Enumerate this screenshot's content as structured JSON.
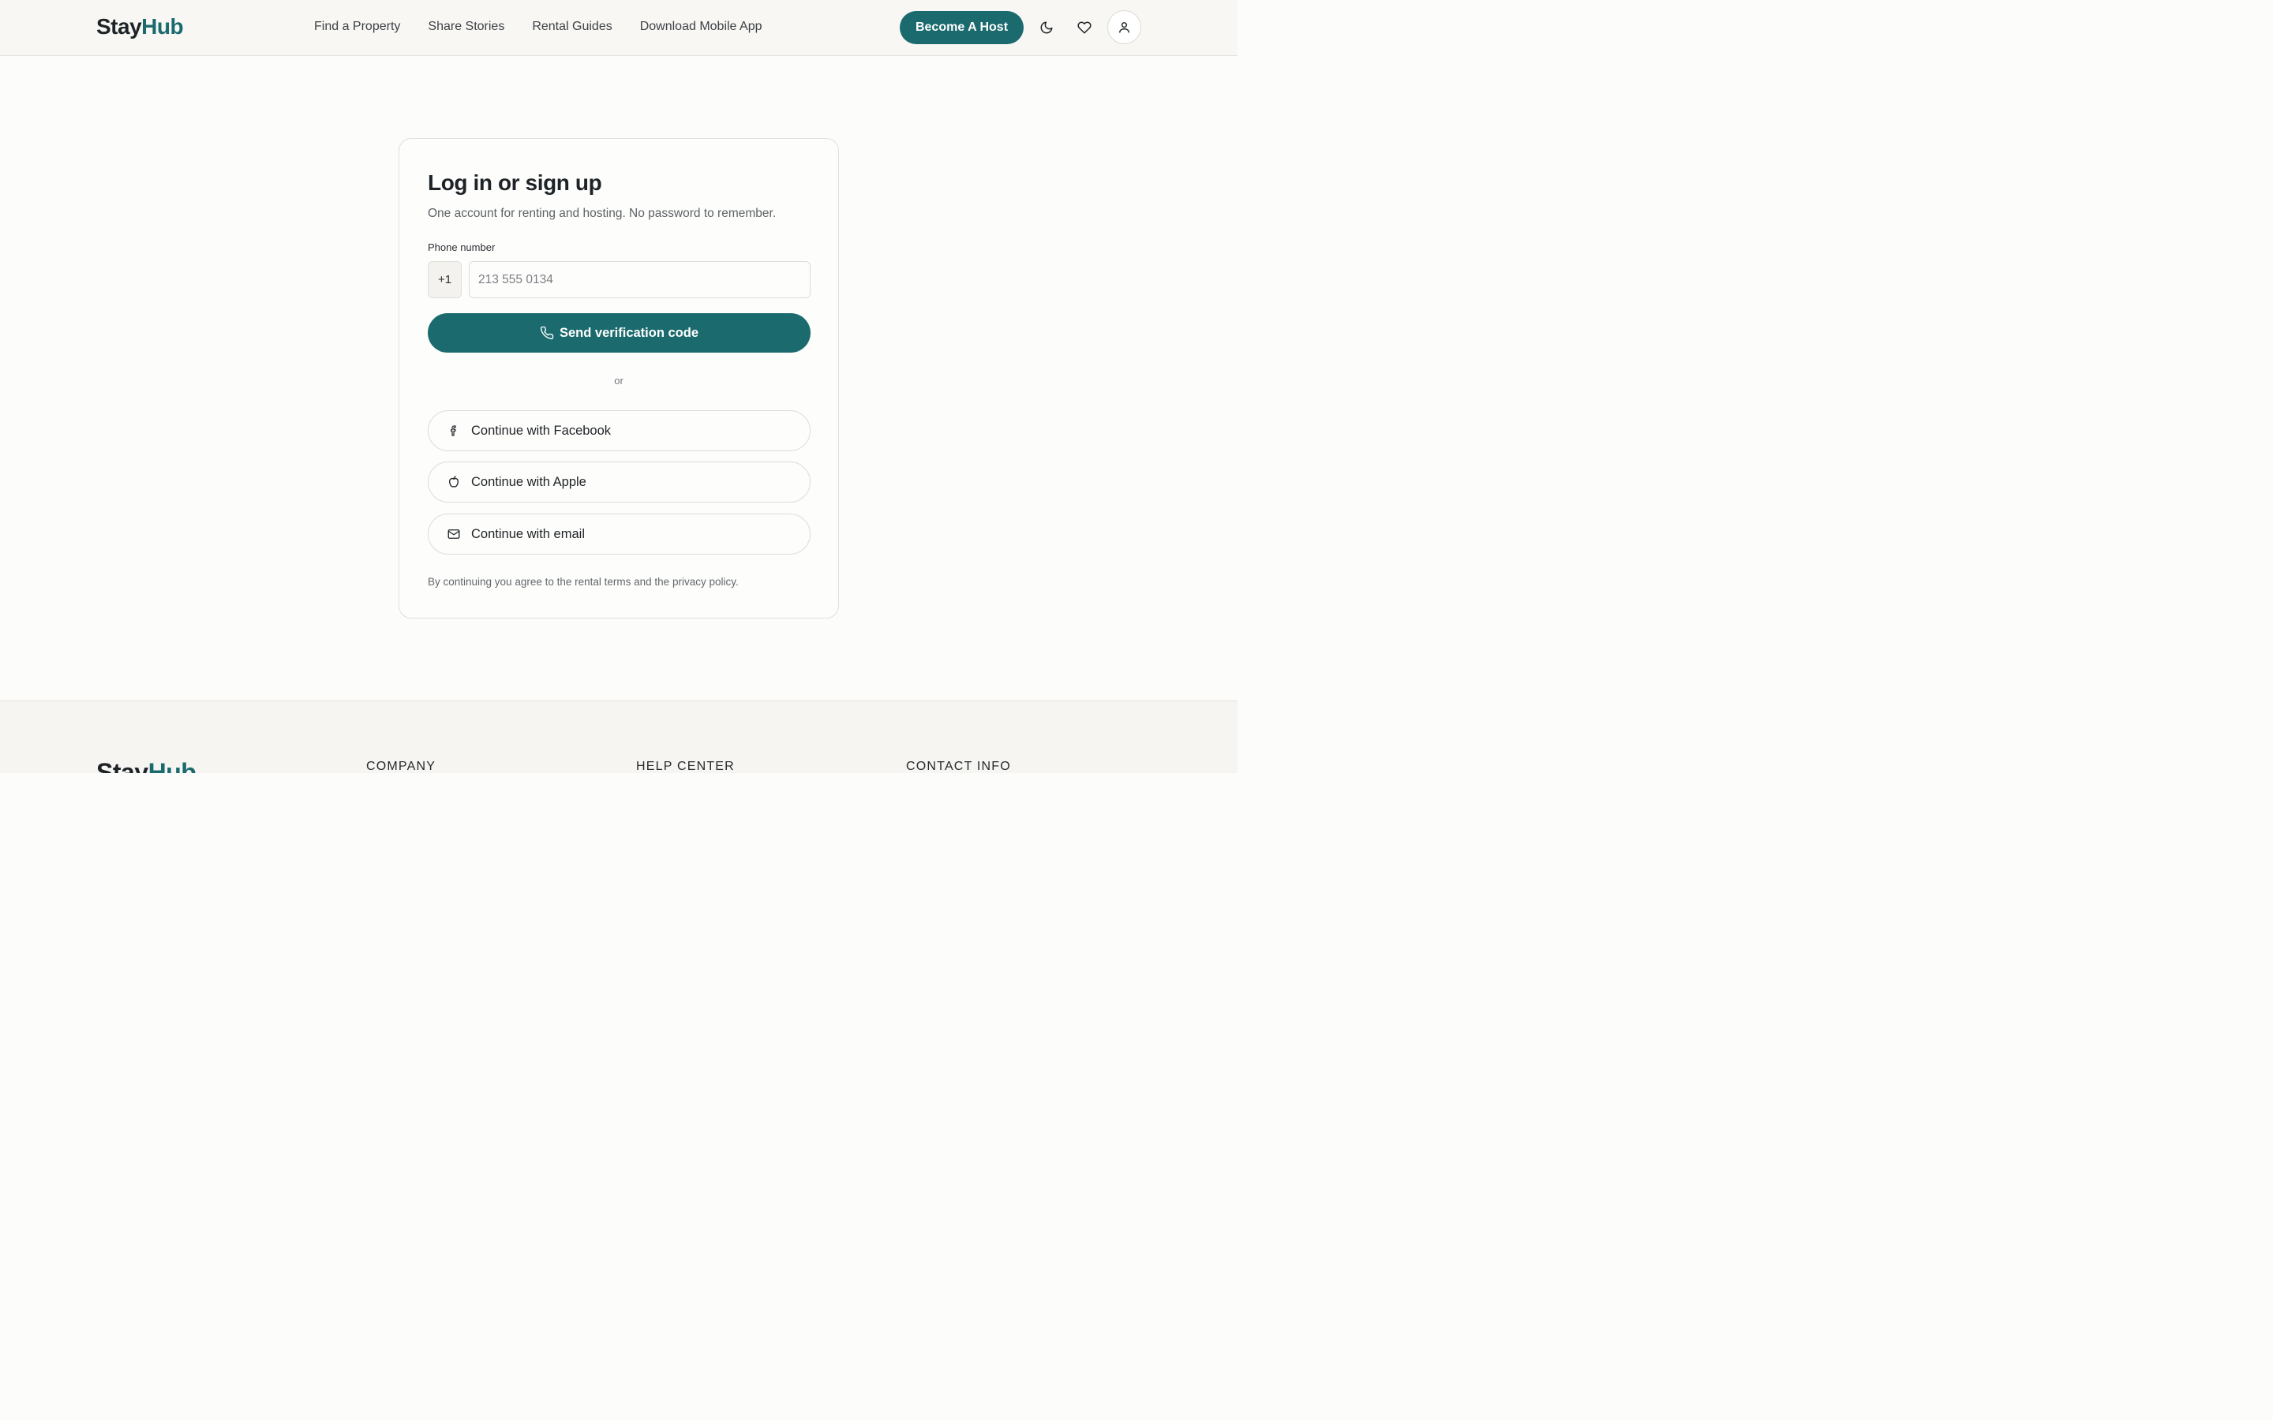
{
  "header": {
    "logo_part1": "Stay",
    "logo_part2": "Hub",
    "nav": [
      "Find a Property",
      "Share Stories",
      "Rental Guides",
      "Download Mobile App"
    ],
    "host_button": "Become A Host",
    "icons": [
      "moon-icon",
      "heart-icon",
      "user-icon"
    ]
  },
  "login": {
    "title": "Log in or sign up",
    "subtitle": "One account for renting and hosting. No password to remember.",
    "phone_label": "Phone number",
    "country_code": "+1",
    "phone_placeholder": "213 555 0134",
    "phone_value": "",
    "send_button": "Send verification code",
    "divider": "or",
    "social": {
      "facebook": "Continue with Facebook",
      "apple": "Continue with Apple",
      "email": "Continue with email"
    },
    "terms": "By continuing you agree to the rental terms and the privacy policy."
  },
  "footer": {
    "logo_part1": "Stay",
    "logo_part2": "Hub",
    "columns": [
      "COMPANY",
      "HELP CENTER",
      "CONTACT INFO"
    ]
  },
  "colors": {
    "accent": "#1b6a6e",
    "background": "#fcfcfa",
    "header_bg": "#f8f7f4"
  }
}
